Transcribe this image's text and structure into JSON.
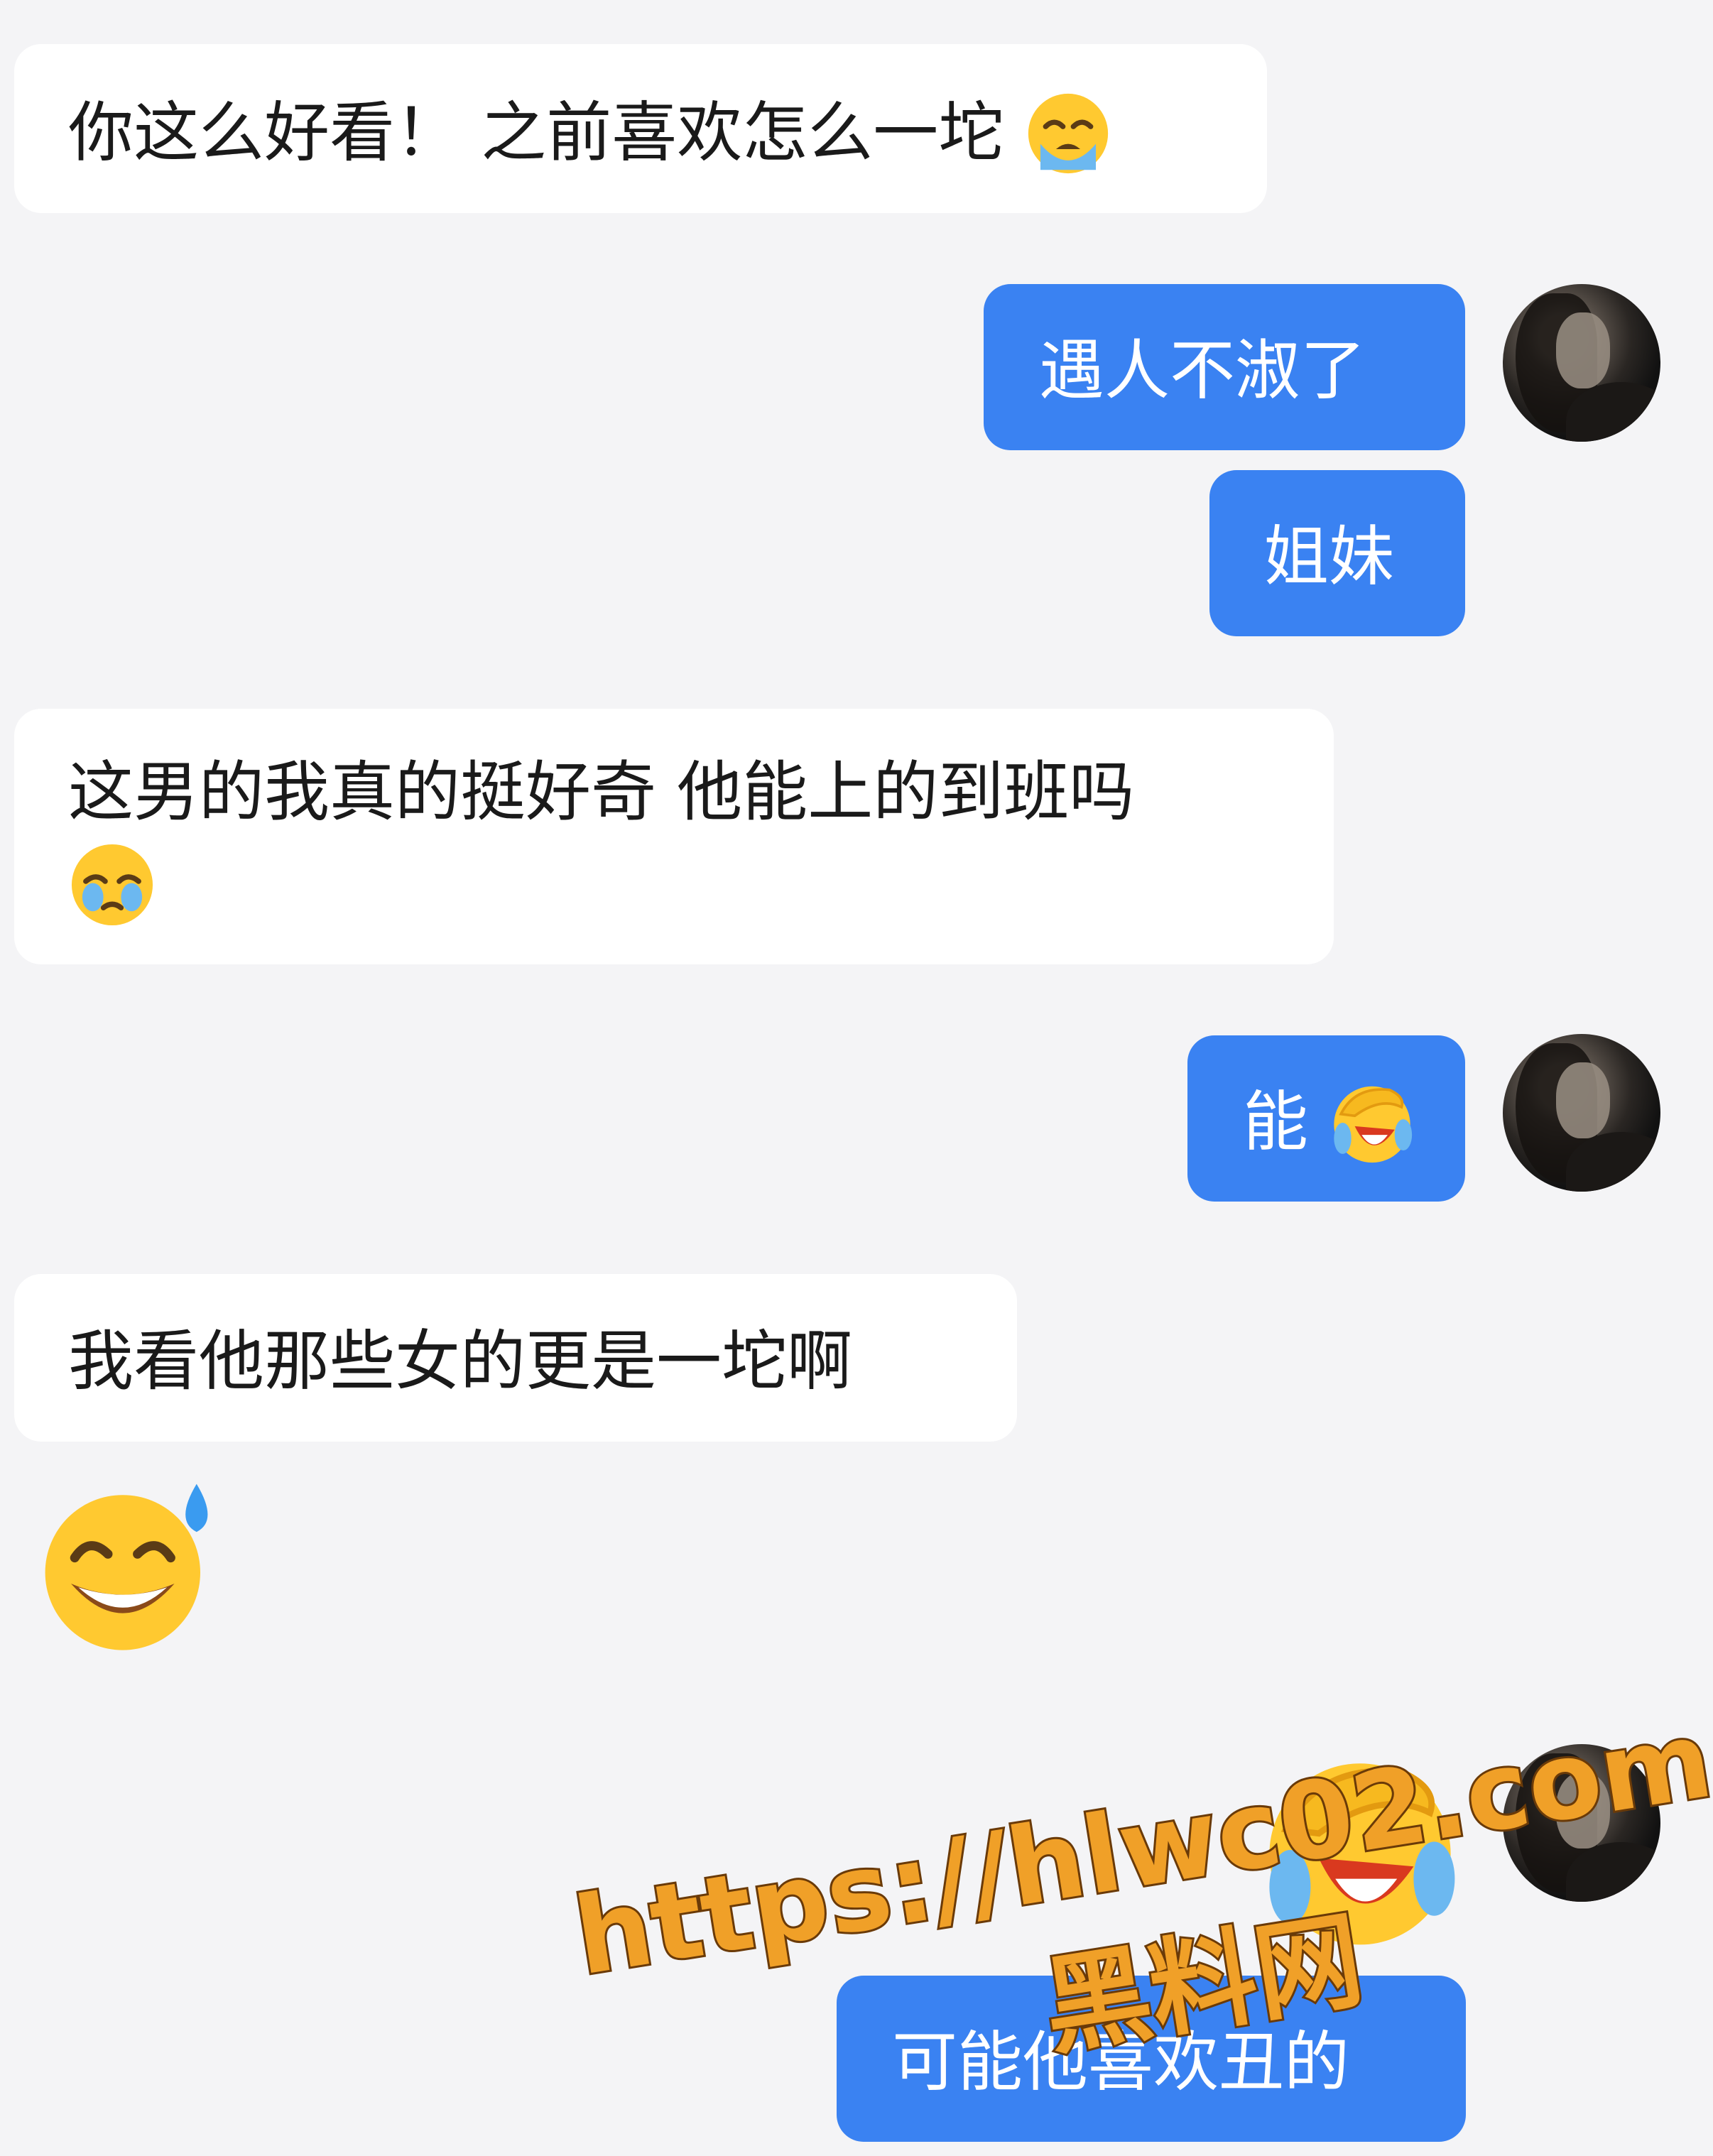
{
  "messages": [
    {
      "side": "incoming",
      "text": "你这么好看！ 之前喜欢怎么一坨",
      "emoji": "loudly-crying-face"
    },
    {
      "side": "outgoing",
      "text": "遇人不淑了"
    },
    {
      "side": "outgoing",
      "text": "姐妹"
    },
    {
      "side": "incoming",
      "line1": "这男的我真的挺好奇 他能上的到班吗",
      "emoji": "holding-back-tears-face"
    },
    {
      "side": "outgoing",
      "text": "能",
      "emoji": "face-palm-crying"
    },
    {
      "side": "incoming",
      "text": "我看他那些女的更是一坨啊"
    },
    {
      "side": "incoming",
      "emoji": "grinning-sweat-face"
    },
    {
      "side": "outgoing",
      "emoji": "face-palm-crying"
    },
    {
      "side": "outgoing",
      "text": "可能他喜欢丑的"
    }
  ],
  "watermark": {
    "url": "https://hlwc02.com",
    "site": "黑料网",
    "color": "#f0a028"
  },
  "colors": {
    "background": "#f4f4f6",
    "incoming_bubble": "#ffffff",
    "outgoing_bubble": "#3a82f2"
  }
}
